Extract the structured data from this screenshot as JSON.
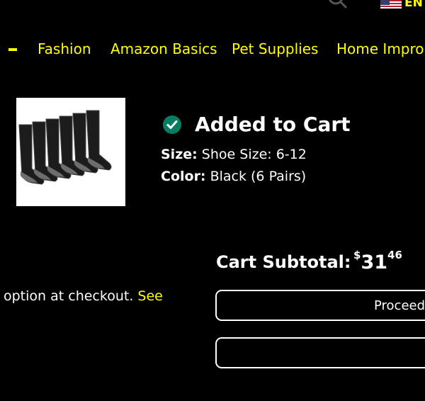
{
  "header": {
    "language": "EN"
  },
  "nav": {
    "items": [
      "Fashion",
      "Amazon Basics",
      "Pet Supplies",
      "Home Impro"
    ]
  },
  "confirmation": {
    "title": "Added to Cart",
    "size_label": "Size:",
    "size_value": "Shoe Size: 6-12",
    "color_label": "Color:",
    "color_value": "Black (6 Pairs)"
  },
  "cart": {
    "subtotal_label": "Cart Subtotal:",
    "currency": "$",
    "price_whole": "31",
    "price_fraction": "46",
    "checkout_note": "option at checkout.",
    "see_link": "See",
    "proceed_button": "Proceed",
    "cart_button": ""
  },
  "colors": {
    "background": "#000000",
    "link": "#ffff00",
    "success": "#067d62"
  },
  "icons": [
    "search-icon",
    "us-flag-icon",
    "check-circle-icon"
  ]
}
